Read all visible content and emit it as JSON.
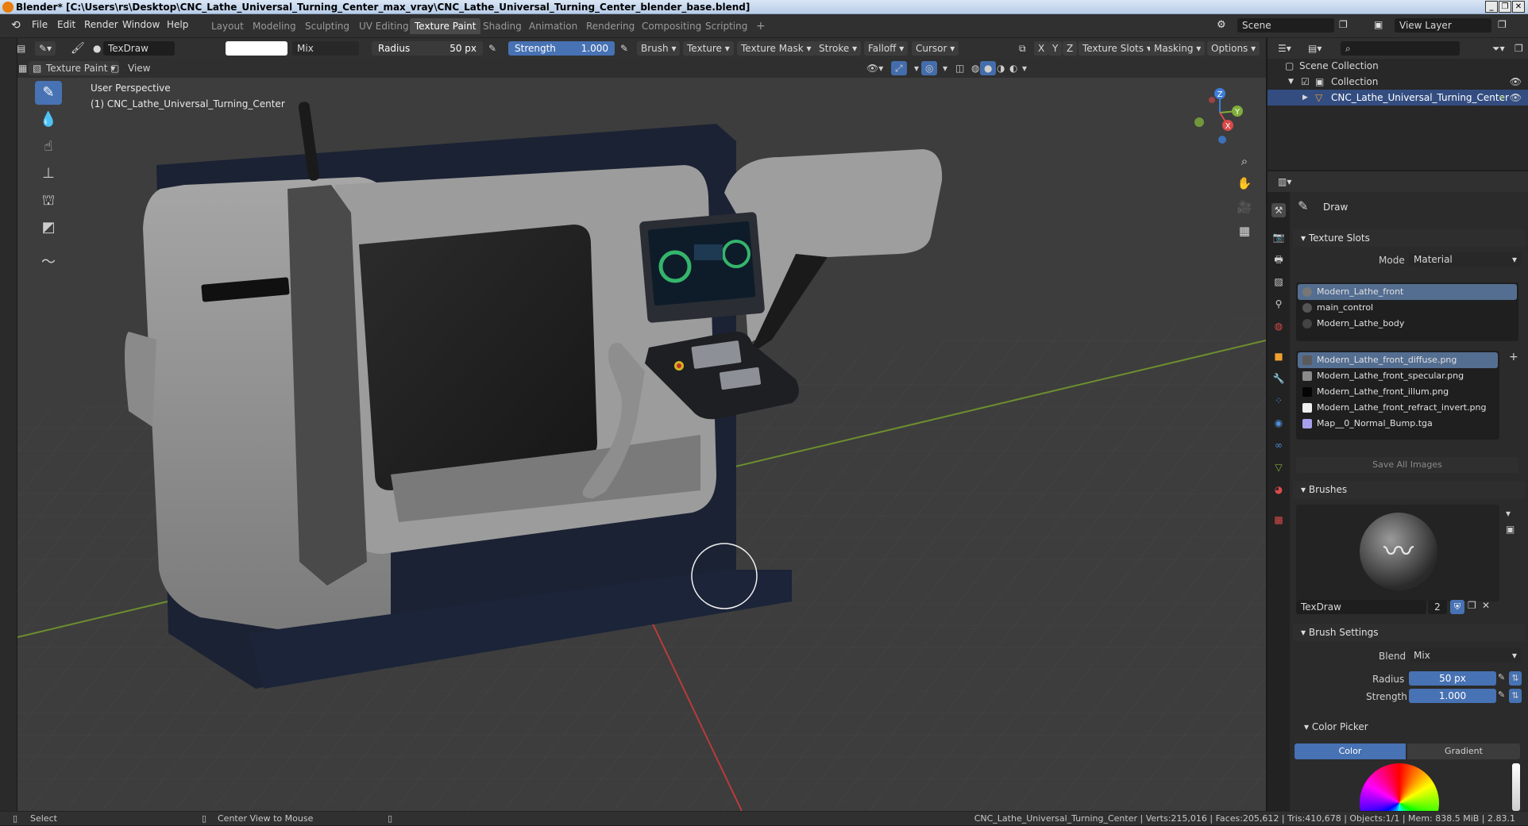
{
  "window": {
    "title": "Blender* [C:\\Users\\rs\\Desktop\\CNC_Lathe_Universal_Turning_Center_max_vray\\CNC_Lathe_Universal_Turning_Center_blender_base.blend]",
    "controls": {
      "min": "_",
      "max": "❐",
      "close": "✕"
    }
  },
  "menubar": {
    "items": [
      "File",
      "Edit",
      "Render",
      "Window",
      "Help"
    ]
  },
  "workspaces": {
    "tabs": [
      "Layout",
      "Modeling",
      "Sculpting",
      "UV Editing",
      "Texture Paint",
      "Shading",
      "Animation",
      "Rendering",
      "Compositing",
      "Scripting"
    ],
    "active": "Texture Paint",
    "add": "+"
  },
  "scene": {
    "label": "Scene"
  },
  "view_layer": {
    "label": "View Layer"
  },
  "tool_header": {
    "brush_name": "TexDraw",
    "blend": "Mix",
    "radius_label": "Radius",
    "radius_value": "50 px",
    "strength_label": "Strength",
    "strength_value": "1.000",
    "menus": [
      "Brush",
      "Texture",
      "Texture Mask",
      "Stroke",
      "Falloff",
      "Cursor"
    ],
    "axes": [
      "X",
      "Y",
      "Z"
    ],
    "right_menus": [
      "Texture Slots",
      "Masking",
      "Options"
    ]
  },
  "viewport_header": {
    "mode": "Texture Paint",
    "view": "View"
  },
  "viewport": {
    "perspective": "User Perspective",
    "object": "(1) CNC_Lathe_Universal_Turning_Center",
    "gizmo_axes": {
      "z": "Z",
      "y": "Y",
      "x": "X"
    },
    "colors": {
      "bg": "#3d3d3d",
      "x_axis": "#d94a4a",
      "y_axis": "#7fae3a",
      "z_axis": "#3d7ed9"
    }
  },
  "outliner": {
    "scene_collection": "Scene Collection",
    "collection": "Collection",
    "object": "CNC_Lathe_Universal_Turning_Center"
  },
  "properties": {
    "tool_name": "Draw",
    "texture_slots": {
      "title": "Texture Slots",
      "mode_label": "Mode",
      "mode_value": "Material",
      "materials": [
        "Modern_Lathe_front",
        "main_control",
        "Modern_Lathe_body"
      ],
      "images": [
        {
          "name": "Modern_Lathe_front_diffuse.png",
          "color": "#5a5a5a"
        },
        {
          "name": "Modern_Lathe_front_specular.png",
          "color": "#8a8a8a"
        },
        {
          "name": "Modern_Lathe_front_illum.png",
          "color": "#050505"
        },
        {
          "name": "Modern_Lathe_front_refract_invert.png",
          "color": "#f0f0f0"
        },
        {
          "name": "Map__0_Normal_Bump.tga",
          "color": "#a8a0ee"
        }
      ],
      "save_all": "Save All Images"
    },
    "brushes": {
      "title": "Brushes",
      "name": "TexDraw",
      "users": "2"
    },
    "brush_settings": {
      "title": "Brush Settings",
      "blend_label": "Blend",
      "blend_value": "Mix",
      "radius_label": "Radius",
      "radius_value": "50 px",
      "strength_label": "Strength",
      "strength_value": "1.000"
    },
    "color_picker": {
      "title": "Color Picker",
      "tabs": [
        "Color",
        "Gradient"
      ],
      "active": "Color"
    }
  },
  "statusbar": {
    "left": "Select",
    "middle": "Center View to Mouse",
    "stats": "CNC_Lathe_Universal_Turning_Center | Verts:215,016 | Faces:205,612 | Tris:410,678 | Objects:1/1 | Mem: 838.5 MiB | 2.83.1"
  },
  "accent": "#4772b3"
}
